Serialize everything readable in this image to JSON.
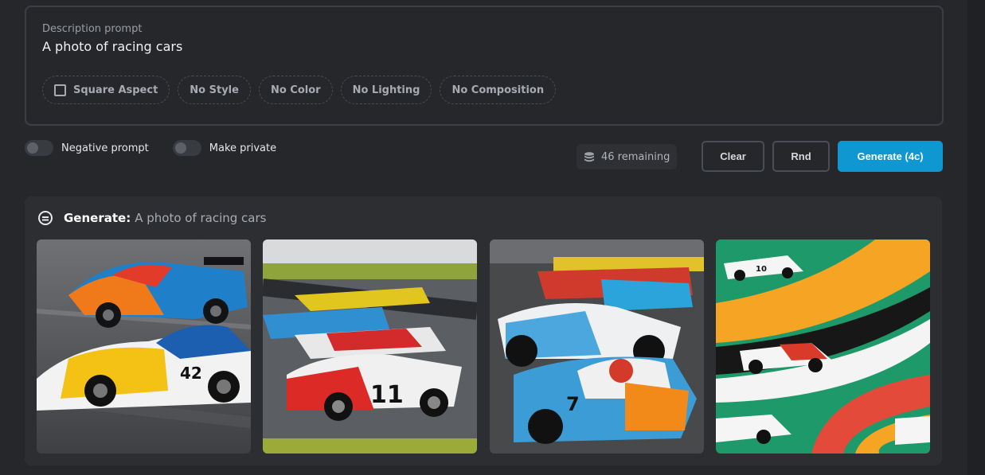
{
  "prompt": {
    "label": "Description prompt",
    "value": "A photo of racing cars",
    "chips": [
      {
        "label": "Square Aspect",
        "checkbox": true,
        "checked": false
      },
      {
        "label": "No Style"
      },
      {
        "label": "No Color"
      },
      {
        "label": "No Lighting"
      },
      {
        "label": "No Composition"
      }
    ]
  },
  "toggles": [
    {
      "label": "Negative prompt",
      "on": false
    },
    {
      "label": "Make private",
      "on": false
    }
  ],
  "credits": {
    "text": "46 remaining",
    "icon": "coins-stack-icon"
  },
  "actions": {
    "clear": "Clear",
    "rnd": "Rnd",
    "generate": "Generate (4c)"
  },
  "result": {
    "heading": "Generate:",
    "prompt": "A photo of racing cars",
    "icon": "generate-result-icon",
    "images": [
      {
        "number": "42"
      },
      {
        "number": "11"
      },
      {
        "number": "7"
      },
      {
        "number": "10"
      }
    ]
  },
  "colors": {
    "accent": "#0f97d1",
    "background": "#25272b",
    "panel": "#2c2e32"
  }
}
